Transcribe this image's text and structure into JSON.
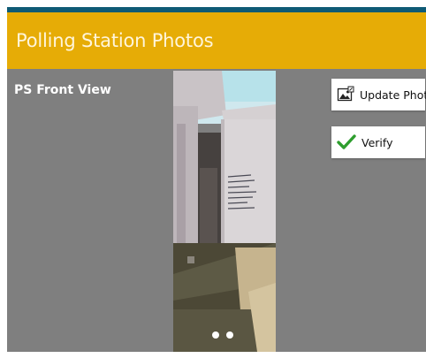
{
  "app_bar": {
    "title": "Polling Station Photos",
    "color": "#e6ac06"
  },
  "status_bar": {
    "color": "#0f5a75"
  },
  "section": {
    "label": "PS Front View"
  },
  "actions": {
    "update_photo": {
      "label": "Update Photo",
      "icon": "image-edit-icon"
    },
    "verify": {
      "label": "Verify",
      "icon": "checkmark-icon",
      "icon_color": "#2e9e2e"
    }
  },
  "carousel": {
    "page_count": 2
  }
}
